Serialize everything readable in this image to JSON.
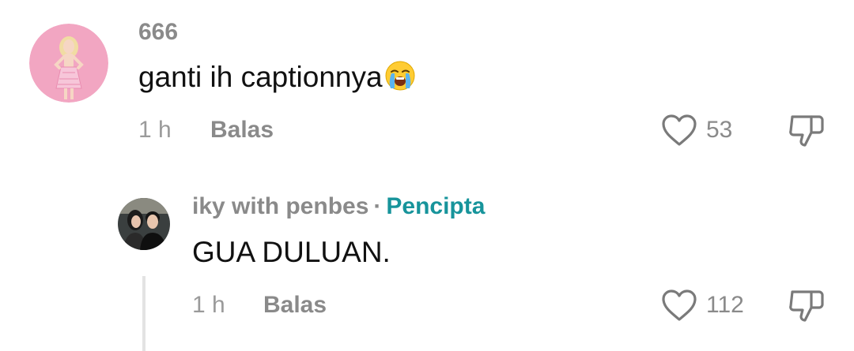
{
  "comments": [
    {
      "username": "666",
      "text": "ganti ih captionnya",
      "emoji": "loudly-crying-face",
      "time": "1 h",
      "reply_label": "Balas",
      "likes": "53"
    }
  ],
  "reply": {
    "username": "iky with penbes",
    "separator": "·",
    "badge": "Pencipta",
    "text": "GUA DULUAN.",
    "time": "1 h",
    "reply_label": "Balas",
    "likes": "112"
  },
  "colors": {
    "creator_badge": "#17949b",
    "muted_text": "#8a8a8a",
    "avatar_pink": "#f2a4c0"
  }
}
